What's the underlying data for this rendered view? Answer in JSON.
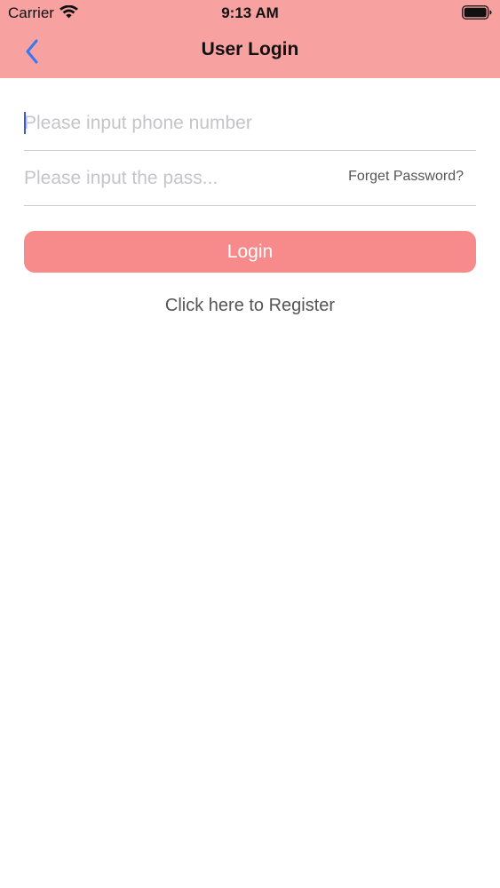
{
  "status_bar": {
    "carrier": "Carrier",
    "time": "9:13 AM",
    "wifi_icon": "wifi-icon",
    "battery_icon": "battery-icon"
  },
  "nav": {
    "title": "User Login",
    "back_icon": "chevron-left-icon"
  },
  "form": {
    "phone_placeholder": "Please input phone number",
    "phone_value": "",
    "password_placeholder": "Please input the pass...",
    "password_value": "",
    "forget_label": "Forget Password?",
    "login_label": "Login",
    "register_label": "Click here to Register"
  },
  "colors": {
    "header_bg": "#f7a1a1",
    "button_bg": "#f78b8b",
    "back_icon": "#3478f6",
    "caret": "#3a5bd9"
  }
}
